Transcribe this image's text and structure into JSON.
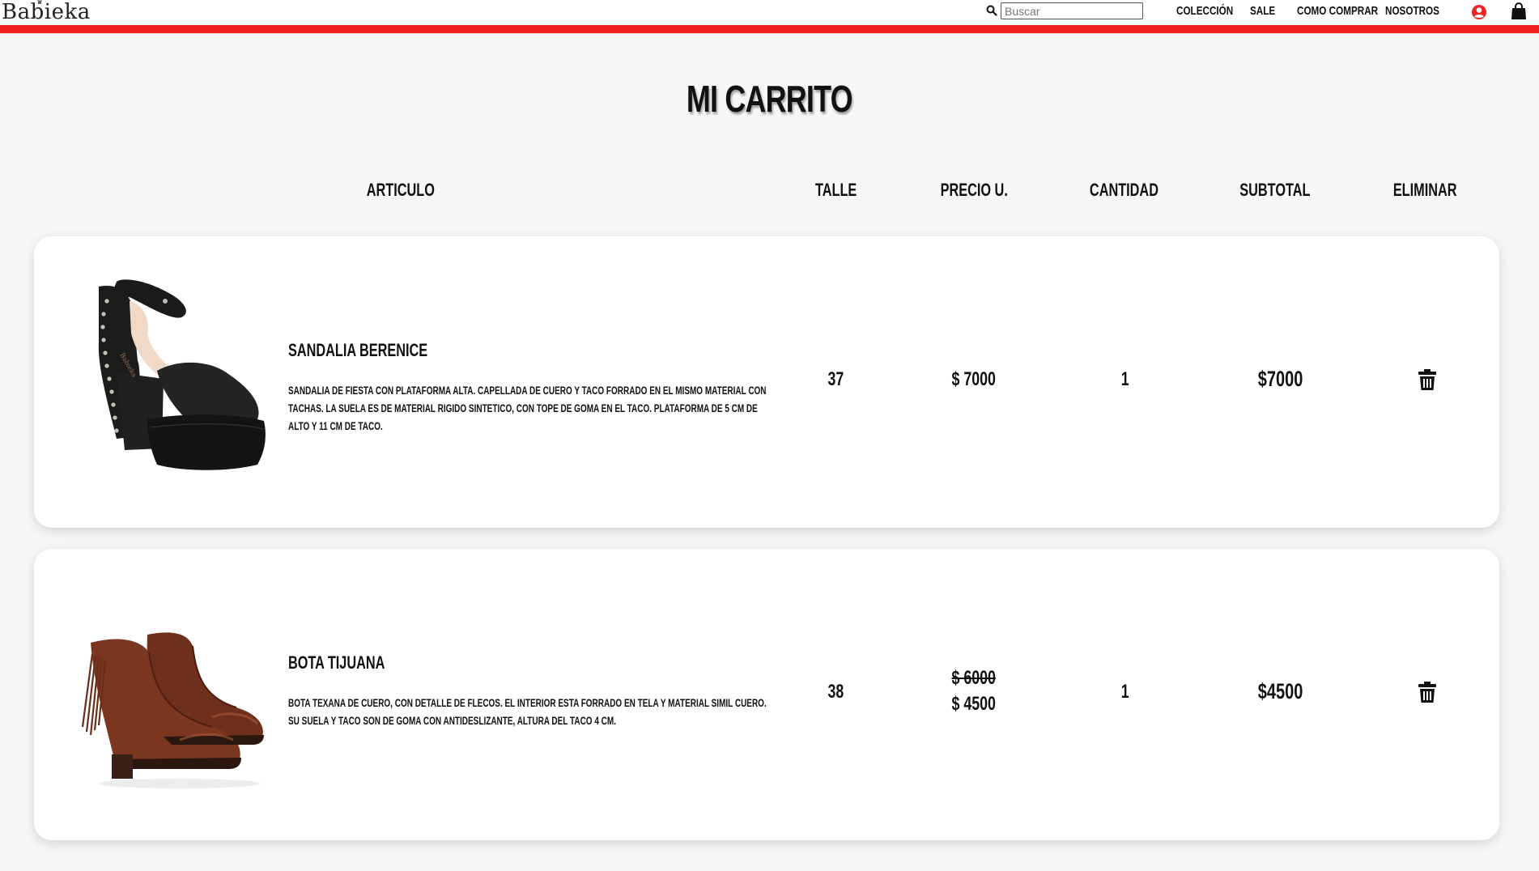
{
  "header": {
    "logo_text": "Babieka",
    "search_placeholder": "Buscar",
    "nav": [
      "COLECCIÓN",
      "SALE",
      "COMO COMPRAR",
      "NOSOTROS"
    ],
    "icons": [
      "search-icon",
      "user-icon",
      "shopping-bag-icon"
    ],
    "accent_color": "#ee2222"
  },
  "page_title": "MI CARRITO",
  "columns": [
    "ARTICULO",
    "TALLE",
    "PRECIO U.",
    "CANTIDAD",
    "SUBTOTAL",
    "ELIMINAR"
  ],
  "items": [
    {
      "name": "SANDALIA BERENICE",
      "description": "SANDALIA DE FIESTA CON PLATAFORMA ALTA. CAPELLADA DE CUERO Y TACO FORRADO EN EL MISMO MATERIAL CON TACHAS. LA SUELA ES DE MATERIAL RIGIDO SINTETICO, CON TOPE DE GOMA EN EL TACO. PLATAFORMA DE 5 CM DE ALTO Y 11 CM DE TACO.",
      "size": "37",
      "price": "$ 7000",
      "quantity": "1",
      "subtotal": "$7000",
      "image": "black-platform-sandal",
      "delete_icon": "trash-icon"
    },
    {
      "name": "BOTA TIJUANA",
      "description": "BOTA TEXANA DE CUERO, CON DETALLE DE FLECOS. EL INTERIOR ESTA FORRADO EN TELA Y MATERIAL SIMIL CUERO. SU SUELA Y TACO SON DE GOMA CON ANTIDESLIZANTE, ALTURA DEL TACO 4 CM.",
      "size": "38",
      "old_price": "$ 6000",
      "price": "$ 4500",
      "quantity": "1",
      "subtotal": "$4500",
      "image": "brown-fringe-ankle-boot",
      "delete_icon": "trash-icon"
    }
  ]
}
